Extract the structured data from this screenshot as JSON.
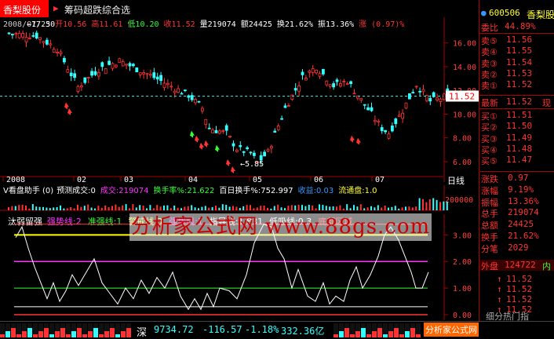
{
  "header": {
    "stock_name": "香梨股份",
    "arrow": "▶",
    "chip_label": "筹码超跌综合选",
    "info": [
      {
        "text": "2008/07/23",
        "color": "#cccccc"
      },
      {
        "text": "开10.56",
        "color": "#ff3333"
      },
      {
        "text": "高11.61",
        "color": "#ff3333"
      },
      {
        "text": "低10.20",
        "color": "#33ff33"
      },
      {
        "text": "收11.52",
        "color": "#ff3333"
      },
      {
        "text": "量219074",
        "color": "#ffffff"
      },
      {
        "text": "额24425",
        "color": "#ffffff"
      },
      {
        "text": "换21.62%",
        "color": "#ffffff"
      },
      {
        "text": "振13.36%",
        "color": "#ffffff"
      },
      {
        "text": "涨 (0.97)%",
        "color": "#ff3333"
      }
    ]
  },
  "kline": {
    "max_label": "17.50",
    "min_label": "5.85",
    "current_price_label": "11.52",
    "ylim": [
      5.2,
      17.9
    ],
    "price_ticks": [
      "16.00",
      "14.00",
      "12.00",
      "10.00",
      "8.00",
      "6.00"
    ],
    "months": [
      "2008",
      "02",
      "03",
      "04",
      "05",
      "06",
      "07"
    ],
    "period_label": "日线"
  },
  "volume": {
    "title": "V看盘助手 (0)",
    "items": [
      {
        "text": "预测成交:0",
        "color": "#ffffff"
      },
      {
        "text": "成交:219074",
        "color": "#ff33ff"
      },
      {
        "text": "换手率%:21.622",
        "color": "#33ff33"
      },
      {
        "text": "百日换手%:752.997",
        "color": "#ffffff"
      },
      {
        "text": "收益:0.03",
        "color": "#3399ff"
      },
      {
        "text": "流通盘:1.0",
        "color": "#ffff33"
      }
    ],
    "tick": "200000"
  },
  "indicator": {
    "title": "汰弱留强",
    "items": [
      {
        "text": "强势线:2",
        "color": "#ff33ff"
      },
      {
        "text": "准强线:1",
        "color": "#33ff33"
      },
      {
        "text": "警戒线:3",
        "color": "#ffff33"
      },
      {
        "text": "强势线:1",
        "color": "#ff33ff"
      },
      {
        "text": "指导线:1.831",
        "color": "#ffffff"
      },
      {
        "text": "低吸线:0.3",
        "color": "#ffffff"
      },
      {
        "text": "底部区域",
        "color": "#ff3333"
      }
    ],
    "ylim": [
      0,
      3.6
    ],
    "ticks": [
      "3.00",
      "2.00",
      "1.00",
      "0.00"
    ]
  },
  "watermark": "分析家公式网 www.88gs.com",
  "quote": {
    "code": "600506",
    "name": "香梨股",
    "ratio_label": "委比",
    "ratio_value": "44.89%",
    "sells": [
      {
        "label": "卖⑤",
        "price": "11.56"
      },
      {
        "label": "卖④",
        "price": "11.55"
      },
      {
        "label": "卖③",
        "price": "11.54"
      },
      {
        "label": "卖②",
        "price": "11.53"
      },
      {
        "label": "卖①",
        "price": "11.52"
      }
    ],
    "latest_label": "最新",
    "latest_value": "11.52",
    "latest_suffix": "现",
    "buys": [
      {
        "label": "买①",
        "price": "11.51"
      },
      {
        "label": "买②",
        "price": "11.50"
      },
      {
        "label": "买③",
        "price": "11.49"
      },
      {
        "label": "买④",
        "price": "11.48"
      },
      {
        "label": "买⑤",
        "price": "11.47"
      }
    ],
    "stats": [
      {
        "label": "涨跌",
        "value": "0.97"
      },
      {
        "label": "涨幅",
        "value": "9.19%"
      },
      {
        "label": "振幅",
        "value": "13.36%"
      },
      {
        "label": "总手",
        "value": "219074"
      },
      {
        "label": "总额",
        "value": "24425"
      },
      {
        "label": "换手",
        "value": "21.62%"
      },
      {
        "label": "分笔",
        "value": "2029"
      }
    ],
    "outer_label": "外盘",
    "outer_value": "124722",
    "inner_label": "内",
    "ticks": [
      "11.52",
      "11.52",
      "11.52",
      "11.52"
    ],
    "bottom_label": "细分热门指"
  },
  "status": {
    "market": "深",
    "index": "9734.72",
    "change": "-116.57",
    "pct": "-1.18%",
    "amount": "332.36亿",
    "brand": "分析家公式网"
  },
  "colors": {
    "up": "#ff3333",
    "down": "#33ffff",
    "grid": "#aa0000"
  }
}
